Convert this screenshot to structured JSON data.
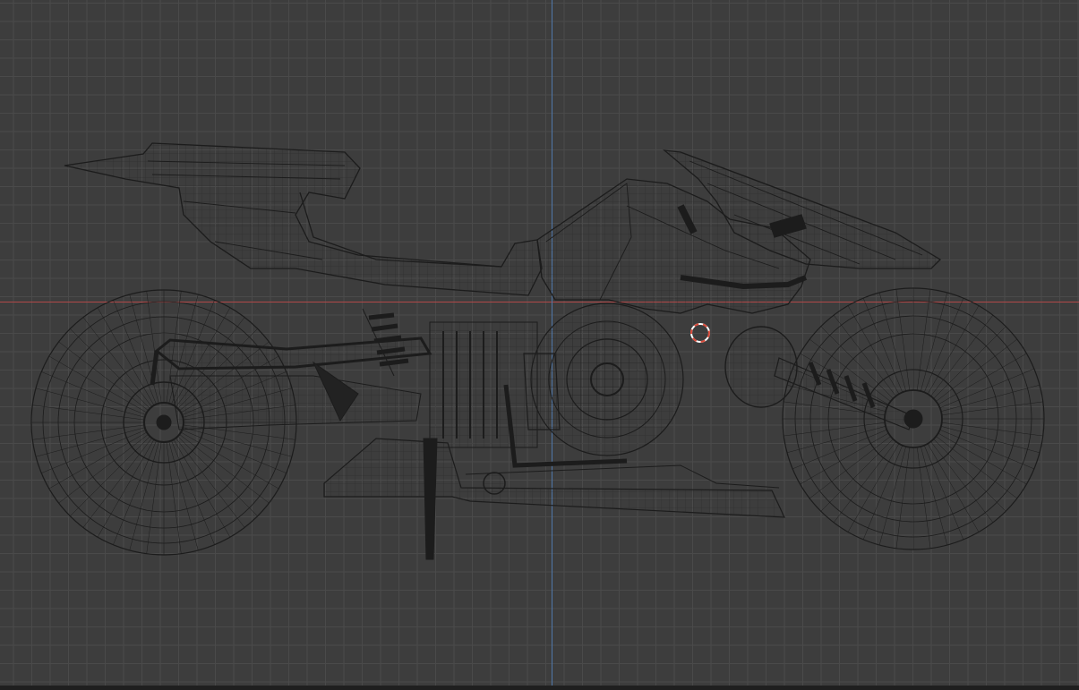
{
  "viewport": {
    "view": "orthographic-side",
    "shading": "wireframe",
    "object": "motorcycle",
    "colors": {
      "background": "#3d3d3d",
      "grid": "#4a4a4a",
      "x_axis": "#b04848",
      "z_axis": "#4f77a9",
      "wire": "#1c1c1c",
      "cursor_red": "#d94a3a",
      "cursor_white": "#ffffff"
    }
  }
}
